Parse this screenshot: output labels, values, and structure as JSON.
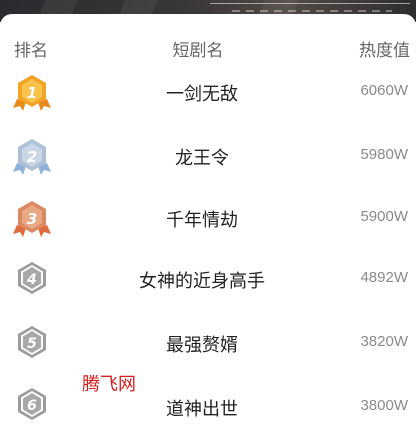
{
  "headers": {
    "rank": "排名",
    "name": "短剧名",
    "heat": "热度值"
  },
  "rows": [
    {
      "rank": "1",
      "medal": "gold",
      "name": "一剑无敌",
      "heat": "6060W"
    },
    {
      "rank": "2",
      "medal": "silver",
      "name": "龙王令",
      "heat": "5980W"
    },
    {
      "rank": "3",
      "medal": "bronze",
      "name": "千年情劫",
      "heat": "5900W"
    },
    {
      "rank": "4",
      "medal": "plain",
      "name": "女神的近身高手",
      "heat": "4892W"
    },
    {
      "rank": "5",
      "medal": "plain",
      "name": "最强赘婿",
      "heat": "3820W"
    },
    {
      "rank": "6",
      "medal": "plain",
      "name": "道神出世",
      "heat": "3800W"
    }
  ],
  "watermark": "腾飞网",
  "colors": {
    "gold": "#f3a326",
    "silver": "#aebfd6",
    "bronze": "#d98a62",
    "plain": "#9c9c9c",
    "watermark": "#d81e1e"
  }
}
